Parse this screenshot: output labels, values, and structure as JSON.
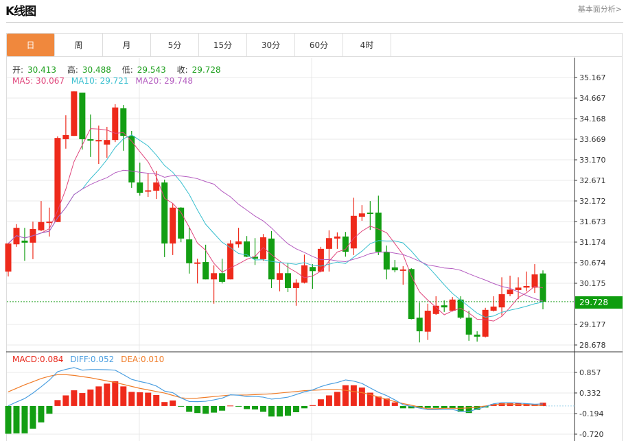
{
  "header": {
    "title": "K线图",
    "link": "基本面分析>"
  },
  "tabs": [
    {
      "label": "日",
      "active": true
    },
    {
      "label": "周"
    },
    {
      "label": "月"
    },
    {
      "label": "5分"
    },
    {
      "label": "15分"
    },
    {
      "label": "30分"
    },
    {
      "label": "60分"
    },
    {
      "label": "4时"
    }
  ],
  "ohlc_info": {
    "open_label": "开:",
    "open": "30.413",
    "high_label": "高:",
    "high": "30.488",
    "low_label": "低:",
    "low": "29.543",
    "close_label": "收:",
    "close": "29.728"
  },
  "ma_info": {
    "ma5": "MA5: 30.067",
    "ma10": "MA10: 29.721",
    "ma20": "MA20: 29.748"
  },
  "macd_info": {
    "macd": "MACD:0.084",
    "diff": "DIFF:0.052",
    "dea": "DEA:0.010"
  },
  "current_price": "29.728",
  "colors": {
    "up": "#ee2a1b",
    "down": "#139e13",
    "ma5": "#e0457b",
    "ma10": "#38bfcf",
    "ma20": "#b45cc0",
    "diff": "#4a9ee0",
    "dea": "#f07c28",
    "active_tab": "#f0883d"
  },
  "chart_data": {
    "type": "candlestick",
    "price_ticks": [
      "35.167",
      "34.667",
      "34.168",
      "33.669",
      "33.170",
      "32.671",
      "32.172",
      "31.673",
      "31.174",
      "30.674",
      "30.175",
      "29.177",
      "28.678"
    ],
    "price_range": [
      28.678,
      35.167
    ],
    "macd_ticks": [
      "0.857",
      "0.332",
      "-0.194",
      "-0.720"
    ],
    "macd_range": [
      -0.72,
      0.857
    ],
    "candles": [
      [
        30.46,
        31.14,
        30.34,
        31.14
      ],
      [
        31.12,
        31.61,
        31.06,
        31.52
      ],
      [
        31.21,
        31.52,
        30.72,
        31.16
      ],
      [
        31.16,
        31.67,
        30.76,
        31.49
      ],
      [
        31.46,
        32.17,
        31.44,
        31.66
      ],
      [
        31.66,
        32.01,
        31.31,
        31.67
      ],
      [
        31.66,
        33.74,
        31.66,
        33.7
      ],
      [
        33.67,
        34.25,
        33.44,
        33.77
      ],
      [
        33.75,
        34.83,
        33.75,
        34.83
      ],
      [
        34.8,
        34.8,
        33.42,
        33.67
      ],
      [
        33.67,
        34.27,
        33.24,
        33.66
      ],
      [
        33.64,
        34.0,
        33.07,
        33.65
      ],
      [
        33.54,
        33.97,
        33.22,
        33.65
      ],
      [
        33.65,
        34.52,
        33.6,
        34.44
      ],
      [
        34.42,
        34.5,
        33.39,
        33.75
      ],
      [
        33.75,
        33.87,
        32.49,
        32.62
      ],
      [
        32.62,
        33.1,
        32.3,
        32.37
      ],
      [
        32.42,
        32.85,
        32.27,
        32.43
      ],
      [
        32.42,
        32.9,
        32.22,
        32.62
      ],
      [
        32.62,
        32.69,
        30.81,
        31.14
      ],
      [
        31.14,
        32.11,
        30.86,
        32.01
      ],
      [
        32.01,
        32.02,
        31.17,
        31.26
      ],
      [
        31.24,
        31.52,
        30.41,
        30.66
      ],
      [
        30.67,
        30.77,
        30.17,
        30.68
      ],
      [
        30.69,
        31.11,
        30.27,
        30.27
      ],
      [
        30.27,
        30.61,
        29.68,
        30.42
      ],
      [
        30.42,
        30.77,
        30.17,
        30.21
      ],
      [
        30.27,
        31.22,
        30.27,
        31.14
      ],
      [
        31.12,
        31.52,
        31.04,
        31.19
      ],
      [
        31.19,
        31.32,
        30.81,
        30.82
      ],
      [
        30.82,
        31.27,
        30.62,
        30.77
      ],
      [
        30.76,
        31.37,
        30.72,
        31.29
      ],
      [
        31.26,
        31.44,
        30.06,
        30.27
      ],
      [
        30.26,
        30.67,
        29.98,
        30.42
      ],
      [
        30.42,
        30.67,
        29.96,
        30.06
      ],
      [
        30.06,
        30.27,
        29.63,
        30.19
      ],
      [
        30.19,
        30.87,
        30.17,
        30.61
      ],
      [
        30.57,
        30.64,
        30.04,
        30.47
      ],
      [
        30.46,
        31.06,
        30.44,
        31.01
      ],
      [
        31.01,
        31.46,
        30.46,
        31.27
      ],
      [
        31.26,
        31.41,
        31.01,
        31.31
      ],
      [
        31.31,
        31.42,
        30.82,
        30.94
      ],
      [
        31.02,
        32.25,
        30.86,
        31.81
      ],
      [
        31.79,
        32.07,
        31.69,
        31.87
      ],
      [
        31.89,
        32.17,
        31.47,
        31.88
      ],
      [
        31.89,
        32.3,
        30.86,
        30.94
      ],
      [
        30.94,
        31.09,
        30.27,
        30.51
      ],
      [
        30.56,
        30.74,
        30.44,
        30.49
      ],
      [
        30.5,
        30.59,
        30.14,
        30.51
      ],
      [
        30.52,
        30.54,
        29.3,
        29.31
      ],
      [
        29.34,
        29.71,
        28.74,
        29.01
      ],
      [
        29.0,
        29.68,
        28.8,
        29.51
      ],
      [
        29.43,
        29.86,
        29.41,
        29.63
      ],
      [
        29.64,
        29.76,
        29.48,
        29.59
      ],
      [
        29.51,
        29.84,
        29.49,
        29.78
      ],
      [
        29.78,
        29.86,
        29.31,
        29.34
      ],
      [
        29.34,
        29.51,
        28.78,
        28.93
      ],
      [
        28.93,
        29.01,
        28.76,
        28.88
      ],
      [
        28.88,
        29.58,
        28.86,
        29.53
      ],
      [
        29.51,
        29.86,
        29.49,
        29.61
      ],
      [
        29.59,
        30.32,
        29.39,
        29.91
      ],
      [
        29.91,
        30.36,
        29.86,
        30.02
      ],
      [
        30.01,
        30.32,
        29.79,
        30.07
      ],
      [
        30.07,
        30.46,
        29.98,
        30.11
      ],
      [
        30.07,
        30.64,
        29.94,
        30.39
      ],
      [
        30.413,
        30.488,
        29.543,
        29.728
      ]
    ],
    "macd_hist": [
      -0.71,
      -0.7,
      -0.7,
      -0.58,
      -0.42,
      -0.2,
      0.15,
      0.27,
      0.4,
      0.33,
      0.42,
      0.5,
      0.57,
      0.63,
      0.5,
      0.36,
      0.35,
      0.34,
      0.28,
      0.1,
      0.14,
      -0.01,
      -0.15,
      -0.18,
      -0.2,
      -0.17,
      -0.12,
      0.01,
      -0.01,
      -0.08,
      -0.09,
      -0.15,
      -0.27,
      -0.27,
      -0.25,
      -0.16,
      -0.06,
      0.02,
      0.17,
      0.27,
      0.36,
      0.53,
      0.53,
      0.47,
      0.34,
      0.24,
      0.19,
      0.09,
      -0.06,
      -0.06,
      -0.05,
      -0.05,
      -0.05,
      -0.06,
      -0.06,
      -0.15,
      -0.18,
      -0.1,
      -0.04,
      0.05,
      0.07,
      0.07,
      0.07,
      0.06,
      0.05,
      0.084
    ],
    "dea": [
      0.36,
      0.45,
      0.54,
      0.62,
      0.7,
      0.76,
      0.8,
      0.8,
      0.78,
      0.75,
      0.72,
      0.68,
      0.64,
      0.6,
      0.55,
      0.5,
      0.45,
      0.41,
      0.37,
      0.33,
      0.27,
      0.21,
      0.19,
      0.2,
      0.22,
      0.24,
      0.26,
      0.28,
      0.28,
      0.28,
      0.29,
      0.3,
      0.31,
      0.33,
      0.35,
      0.37,
      0.39,
      0.4,
      0.41,
      0.42,
      0.42,
      0.4,
      0.37,
      0.34,
      0.29,
      0.23,
      0.17,
      0.11,
      0.06,
      0.02,
      -0.03,
      -0.07,
      -0.07,
      -0.06,
      -0.06,
      -0.06,
      -0.05,
      -0.03,
      0.0,
      0.03,
      0.05,
      0.05,
      0.04,
      0.03,
      0.02,
      0.01
    ]
  }
}
